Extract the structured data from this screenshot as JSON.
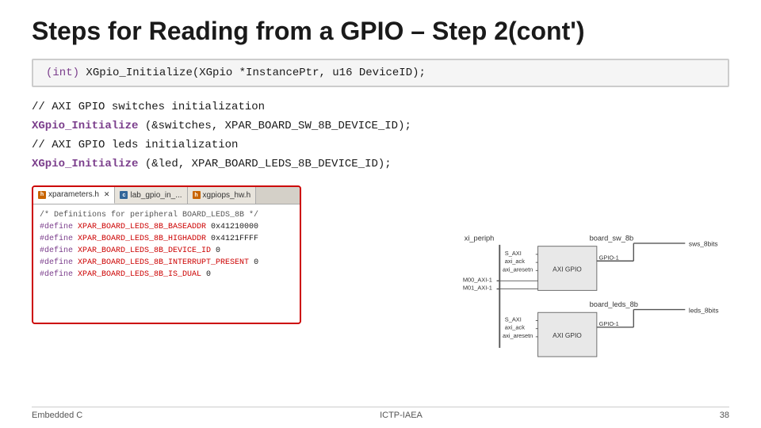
{
  "slide": {
    "title": "Steps for Reading from a GPIO – Step 2(cont')",
    "function_signature": "(int) XGpio_Initialize(XGpio *InstancePtr, u16 DeviceID);",
    "function_keyword": "(int)",
    "code_lines": [
      {
        "type": "comment",
        "text": "// AXI GPIO switches initialization"
      },
      {
        "type": "code",
        "bold": "XGpio_Initialize",
        "rest": " (&switches, XPAR_BOARD_SW_8B_DEVICE_ID);"
      },
      {
        "type": "comment",
        "text": "// AXI GPIO leds initialization"
      },
      {
        "type": "code",
        "bold": "XGpio_Initialize",
        "rest": " (&led, XPAR_BOARD_LEDS_8B_DEVICE_ID);"
      }
    ],
    "eclipse": {
      "tabs": [
        {
          "label": "xparameters.h",
          "icon": "h",
          "active": true
        },
        {
          "label": "lab_gpio_in_...",
          "icon": "c",
          "active": false
        },
        {
          "label": "xgpiops_hw.h",
          "icon": "h",
          "active": false
        }
      ],
      "content_lines": [
        {
          "text": "/* Definitions for peripheral BOARD_LEDS_8B */"
        },
        {
          "keyword": "#define",
          "name": " XPAR_BOARD_LEDS_8B_BASEADDR",
          "value": " 0x41210000"
        },
        {
          "keyword": "#define",
          "name": " XPAR_BOARD_LEDS_8B_HIGHADDR",
          "value": " 0x4121FFFF"
        },
        {
          "keyword": "#define",
          "name": " XPAR_BOARD_LEDS_8B_DEVICE_ID",
          "value": " 0"
        },
        {
          "keyword": "#define",
          "name": " XPAR_BOARD_LEDS_8B_INTERRUPT_PRESENT",
          "value": " 0"
        },
        {
          "keyword": "#define",
          "name": " XPAR_BOARD_LEDS_8B_IS_DUAL",
          "value": " 0"
        }
      ]
    },
    "footer": {
      "left": "Embedded C",
      "center": "ICTP-IAEA",
      "right": "38"
    }
  }
}
